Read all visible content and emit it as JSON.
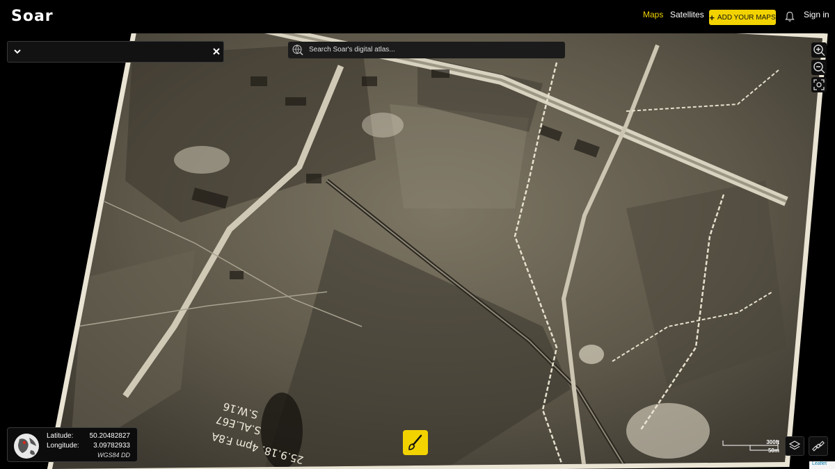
{
  "app": {
    "name": "Soar"
  },
  "nav": {
    "maps": "Maps",
    "satellites": "Satellites",
    "add_maps": "ADD YOUR MAPS",
    "sign_in": "Sign in"
  },
  "search": {
    "placeholder": "Search Soar's digital atlas..."
  },
  "coordinates": {
    "latitude_label": "Latitude:",
    "latitude_value": "50.20482827",
    "longitude_label": "Longitude:",
    "longitude_value": "3.09782933",
    "crs": "WGS84 DD"
  },
  "scale": {
    "feet": "300ft",
    "meters": "50m"
  },
  "attribution": "Leaflet",
  "map_image": {
    "handwriting_line1": "25.9.18. 4pm F.8A",
    "handwriting_line2": "S.AL.E67",
    "handwriting_line3": "S.W.16"
  },
  "colors": {
    "accent": "#f2d300",
    "background": "#000000",
    "panel": "#121212"
  },
  "icons": [
    "chevron-down-icon",
    "close-icon",
    "globe-search-icon",
    "bell-icon",
    "zoom-in-icon",
    "zoom-out-icon",
    "locate-icon",
    "brush-icon",
    "layers-icon",
    "satellite-icon",
    "globe-icon"
  ]
}
